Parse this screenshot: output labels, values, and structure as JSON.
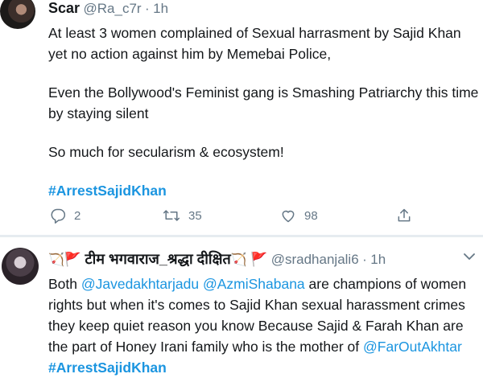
{
  "tweet1": {
    "display_name": "Scar",
    "handle": "@Ra_c7r",
    "separator": "·",
    "time": "1h",
    "lines": [
      "At least 3 women complained of Sexual harrasment by Sajid Khan yet no action against him by Memebai Police,",
      "Even the Bollywood's Feminist gang is Smashing Patriarchy this time by staying silent",
      "So much for secularism & ecosystem!"
    ],
    "hashtag": "#ArrestSajidKhan",
    "actions": {
      "replies": "2",
      "retweets": "35",
      "likes": "98"
    }
  },
  "tweet2": {
    "display_name": "टीम भगवाराज_श्रद्धा दीक्षित",
    "handle": "@sradhanjali6",
    "separator": "·",
    "time": "1h",
    "text": {
      "pre": "Both ",
      "mention1": "@Javedakhtarjadu",
      "mid1": " ",
      "mention2": "@AzmiShabana",
      "mid2": " are champions of women rights but when it's comes to Sajid Khan sexual harassment crimes  they keep quiet reason you know Because Sajid & Farah Khan are the part of Honey Irani family who is the mother of ",
      "mention3": "@FarOutAkhtar"
    },
    "hashtag": "#ArrestSajidKhan"
  },
  "icons": {
    "reply": "reply-icon",
    "retweet": "retweet-icon",
    "like": "heart-icon",
    "share": "share-icon",
    "more": "chevron-down-icon",
    "flag": "red-flag-emoji",
    "bow": "bow-and-arrow-emoji"
  },
  "colors": {
    "link": "#1b95e0",
    "muted": "#657786",
    "text": "#14171a",
    "divider": "#e6ecf0"
  }
}
